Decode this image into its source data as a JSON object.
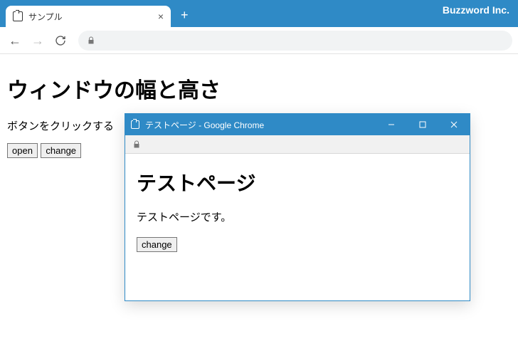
{
  "chrome": {
    "tab_title": "サンプル",
    "brand": "Buzzword Inc."
  },
  "main_page": {
    "heading": "ウィンドウの幅と高さ",
    "text": "ボタンをクリックする",
    "open_button": "open",
    "change_button": "change"
  },
  "popup": {
    "window_title": "テストページ - Google Chrome",
    "heading": "テストページ",
    "text": "テストページです。",
    "change_button": "change"
  }
}
